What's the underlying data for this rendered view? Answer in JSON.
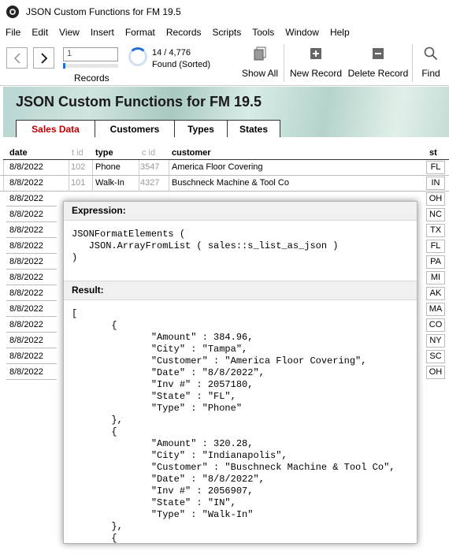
{
  "window": {
    "title": "JSON Custom Functions for FM 19.5"
  },
  "menu": [
    "File",
    "Edit",
    "View",
    "Insert",
    "Format",
    "Records",
    "Scripts",
    "Tools",
    "Window",
    "Help"
  ],
  "toolbar": {
    "record_value": "1",
    "records_label": "Records",
    "found_count": "14 / 4,776",
    "found_label": "Found (Sorted)",
    "show_all": "Show All",
    "new_record": "New Record",
    "delete_record": "Delete Record",
    "find": "Find"
  },
  "header": {
    "title": "JSON Custom Functions for FM 19.5",
    "tabs": [
      "Sales Data",
      "Customers",
      "Types",
      "States"
    ],
    "active_tab": "Sales Data"
  },
  "table": {
    "columns": {
      "date": "date",
      "tid": "t id",
      "type": "type",
      "cid": "c id",
      "customer": "customer",
      "st": "st"
    },
    "rows": [
      {
        "date": "8/8/2022",
        "tid": "102",
        "type": "Phone",
        "cid": "3547",
        "customer": "America Floor Covering",
        "st": "FL"
      },
      {
        "date": "8/8/2022",
        "tid": "101",
        "type": "Walk-In",
        "cid": "4327",
        "customer": "Buschneck Machine & Tool Co",
        "st": "IN"
      },
      {
        "date": "8/8/2022",
        "st": "OH"
      },
      {
        "date": "8/8/2022",
        "st": "NC"
      },
      {
        "date": "8/8/2022",
        "st": "TX"
      },
      {
        "date": "8/8/2022",
        "st": "FL"
      },
      {
        "date": "8/8/2022",
        "st": "PA"
      },
      {
        "date": "8/8/2022",
        "st": "MI"
      },
      {
        "date": "8/8/2022",
        "st": "AK"
      },
      {
        "date": "8/8/2022",
        "st": "MA"
      },
      {
        "date": "8/8/2022",
        "st": "CO"
      },
      {
        "date": "8/8/2022",
        "st": "NY"
      },
      {
        "date": "8/8/2022",
        "st": "SC"
      },
      {
        "date": "8/8/2022",
        "st": "OH"
      }
    ]
  },
  "popup": {
    "expression_label": "Expression:",
    "expression": "JSONFormatElements (\n   JSON.ArrayFromList ( sales::s_list_as_json )\n)",
    "result_label": "Result:",
    "result": "[\n       {\n              \"Amount\" : 384.96,\n              \"City\" : \"Tampa\",\n              \"Customer\" : \"America Floor Covering\",\n              \"Date\" : \"8/8/2022\",\n              \"Inv #\" : 2057180,\n              \"State\" : \"FL\",\n              \"Type\" : \"Phone\"\n       },\n       {\n              \"Amount\" : 320.28,\n              \"City\" : \"Indianapolis\",\n              \"Customer\" : \"Buschneck Machine & Tool Co\",\n              \"Date\" : \"8/8/2022\",\n              \"Inv #\" : 2056907,\n              \"State\" : \"IN\",\n              \"Type\" : \"Walk-In\"\n       },\n       {"
  }
}
